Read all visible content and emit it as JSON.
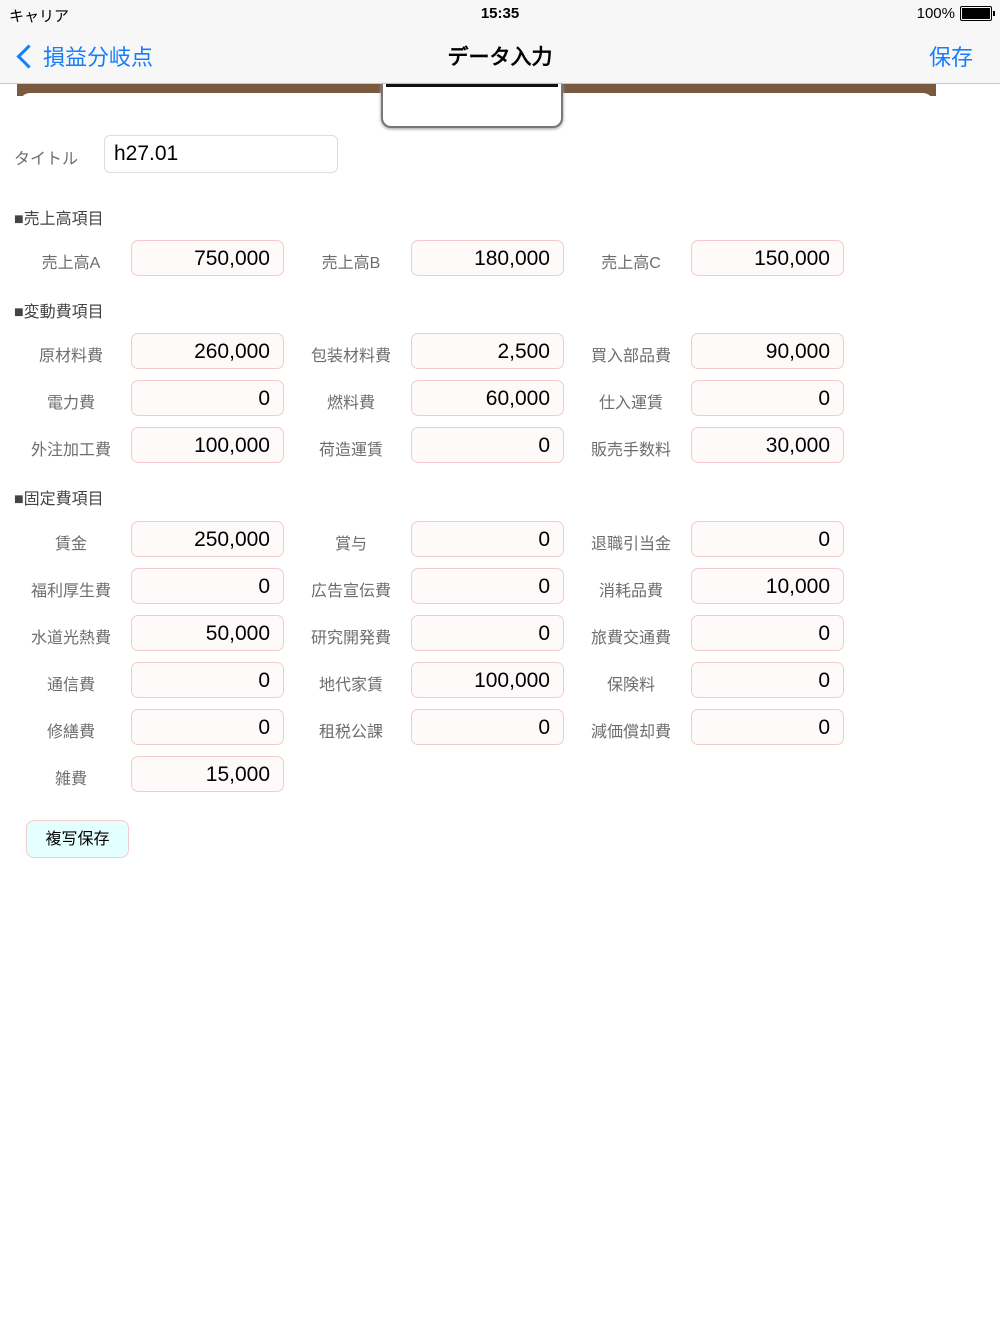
{
  "status_bar": {
    "carrier": "キャリア",
    "time": "15:35",
    "battery": "100%"
  },
  "nav": {
    "back_label": "損益分岐点",
    "title": "データ入力",
    "save_label": "保存"
  },
  "title_field": {
    "label": "タイトル",
    "value": "h27.01"
  },
  "sections": [
    {
      "header": "■売上高項目",
      "fields": [
        {
          "label": "売上高A",
          "value": "750,000"
        },
        {
          "label": "売上高B",
          "value": "180,000"
        },
        {
          "label": "売上高C",
          "value": "150,000"
        }
      ]
    },
    {
      "header": "■変動費項目",
      "fields": [
        {
          "label": "原材料費",
          "value": "260,000"
        },
        {
          "label": "包装材料費",
          "value": "2,500"
        },
        {
          "label": "買入部品費",
          "value": "90,000"
        },
        {
          "label": "電力費",
          "value": "0"
        },
        {
          "label": "燃料費",
          "value": "60,000"
        },
        {
          "label": "仕入運賃",
          "value": "0"
        },
        {
          "label": "外注加工費",
          "value": "100,000"
        },
        {
          "label": "荷造運賃",
          "value": "0"
        },
        {
          "label": "販売手数料",
          "value": "30,000"
        }
      ]
    },
    {
      "header": "■固定費項目",
      "fields": [
        {
          "label": "賃金",
          "value": "250,000"
        },
        {
          "label": "賞与",
          "value": "0"
        },
        {
          "label": "退職引当金",
          "value": "0"
        },
        {
          "label": "福利厚生費",
          "value": "0"
        },
        {
          "label": "広告宣伝費",
          "value": "0"
        },
        {
          "label": "消耗品費",
          "value": "10,000"
        },
        {
          "label": "水道光熱費",
          "value": "50,000"
        },
        {
          "label": "研究開発費",
          "value": "0"
        },
        {
          "label": "旅費交通費",
          "value": "0"
        },
        {
          "label": "通信費",
          "value": "0"
        },
        {
          "label": "地代家賃",
          "value": "100,000"
        },
        {
          "label": "保険料",
          "value": "0"
        },
        {
          "label": "修繕費",
          "value": "0"
        },
        {
          "label": "租税公課",
          "value": "0"
        },
        {
          "label": "減価償却費",
          "value": "0"
        },
        {
          "label": "雑費",
          "value": "15,000"
        }
      ]
    }
  ],
  "copy_save_label": "複写保存"
}
